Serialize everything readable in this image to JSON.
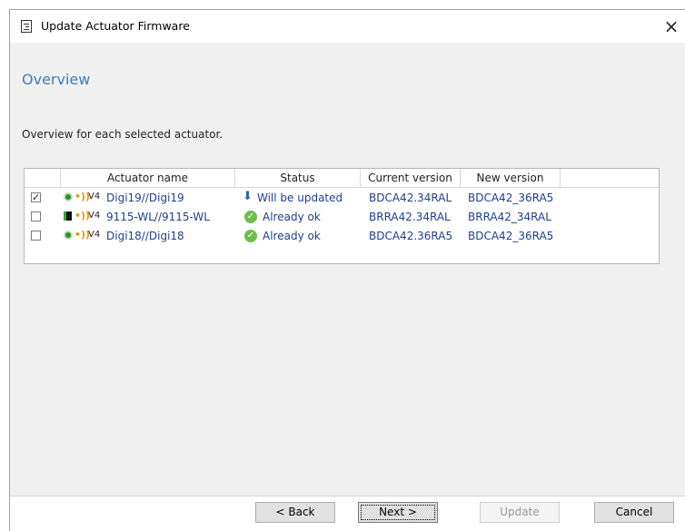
{
  "window": {
    "title": "Update Actuator Firmware"
  },
  "page": {
    "title": "Overview",
    "description": "Overview for each selected actuator."
  },
  "table": {
    "columns": [
      "Actuator name",
      "Status",
      "Current version",
      "New version"
    ],
    "rows": [
      {
        "checked": true,
        "icon": "green-dot-icon",
        "badge": "V4",
        "name": "Digi19//Digi19",
        "status": "Will be updated",
        "status_icon": "download-arrow-icon",
        "current": "BDCA42.34RAL",
        "new": "BDCA42_36RA5"
      },
      {
        "checked": false,
        "icon": "black-square-icon",
        "badge": "V4",
        "name": "9115-WL//9115-WL",
        "status": "Already ok",
        "status_icon": "check-circle-icon",
        "current": "BRRA42.34RAL",
        "new": "BRRA42_34RAL"
      },
      {
        "checked": false,
        "icon": "green-dot-icon",
        "badge": "V4",
        "name": "Digi18//Digi18",
        "status": "Already ok",
        "status_icon": "check-circle-icon",
        "current": "BDCA42.36RA5",
        "new": "BDCA42_36RA5"
      }
    ]
  },
  "buttons": {
    "back": "< Back",
    "next": "Next >",
    "update": "Update",
    "cancel": "Cancel"
  },
  "colors": {
    "accent": "#3a7ebf",
    "link": "#1f3f8f",
    "ok": "#6cbf4d",
    "signal": "#e39a12"
  }
}
